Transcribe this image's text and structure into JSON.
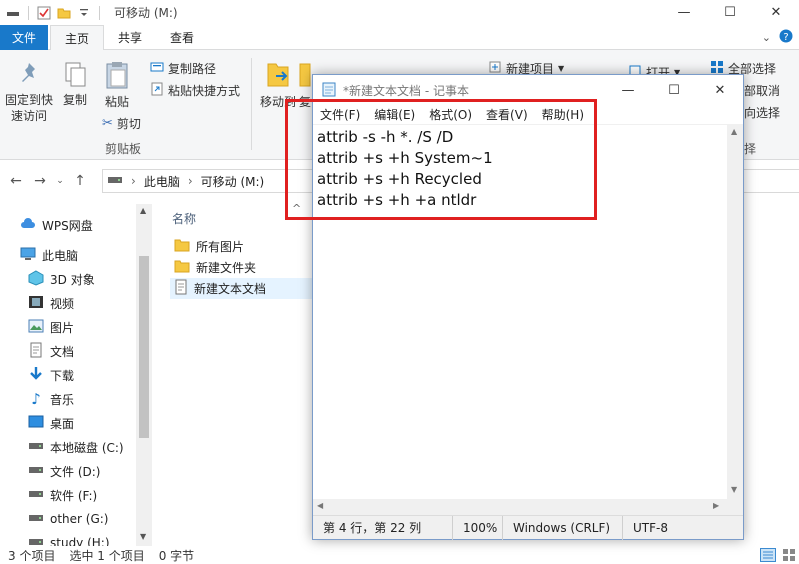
{
  "explorer": {
    "title": "可移动 (M:)",
    "tabs": [
      "文件",
      "主页",
      "共享",
      "查看"
    ],
    "ribbon": {
      "pin_label_1": "固定到快",
      "pin_label_2": "速访问",
      "copy_label": "复制",
      "paste_label": "粘贴",
      "copy_path_label": "复制路径",
      "paste_shortcut_label": "粘贴快捷方式",
      "cut_label": "剪切",
      "clipboard_group": "剪贴板",
      "move_to_label": "移动到",
      "copy_to_label": "复",
      "new_item_label": "新建项目",
      "open_label": "打开",
      "select_all_label": "全部选择",
      "select_none_label": "部取消",
      "invert_label": "向选择",
      "select_group": "择"
    },
    "address": {
      "crumbs": [
        "此电脑",
        "可移动 (M:)"
      ]
    },
    "nav": {
      "items": [
        {
          "label": "WPS网盘",
          "icon": "cloud-icon"
        },
        {
          "label": "此电脑",
          "icon": "computer-icon"
        },
        {
          "label": "3D 对象",
          "icon": "cube-icon"
        },
        {
          "label": "视频",
          "icon": "video-icon"
        },
        {
          "label": "图片",
          "icon": "picture-icon"
        },
        {
          "label": "文档",
          "icon": "document-icon"
        },
        {
          "label": "下载",
          "icon": "download-icon"
        },
        {
          "label": "音乐",
          "icon": "music-icon"
        },
        {
          "label": "桌面",
          "icon": "desktop-icon"
        },
        {
          "label": "本地磁盘 (C:)",
          "icon": "drive-icon"
        },
        {
          "label": "文件 (D:)",
          "icon": "drive-icon"
        },
        {
          "label": "软件 (F:)",
          "icon": "drive-icon"
        },
        {
          "label": "other (G:)",
          "icon": "drive-icon"
        },
        {
          "label": "study (H:)",
          "icon": "drive-icon"
        }
      ]
    },
    "filelist": {
      "column_name": "名称",
      "files": [
        {
          "name": "所有图片",
          "type": "folder"
        },
        {
          "name": "新建文件夹",
          "type": "folder"
        },
        {
          "name": "新建文本文档",
          "type": "text"
        }
      ]
    },
    "status": {
      "count": "3 个项目",
      "selected": "选中 1 个项目",
      "size": "0 字节"
    }
  },
  "notepad": {
    "title": "*新建文本文档 - 记事本",
    "menu": [
      "文件(F)",
      "编辑(E)",
      "格式(O)",
      "查看(V)",
      "帮助(H)"
    ],
    "lines": [
      "attrib -s -h *. /S /D",
      "attrib +s +h System~1",
      "attrib +s +h Recycled",
      "attrib +s +h +a ntldr"
    ],
    "status": {
      "position": "第 4 行，第 22 列",
      "zoom": "100%",
      "eol": "Windows (CRLF)",
      "encoding": "UTF-8"
    }
  },
  "colors": {
    "file_tab": "#1979ca",
    "highlight": "#e02020",
    "selection": "#e5f3ff"
  }
}
